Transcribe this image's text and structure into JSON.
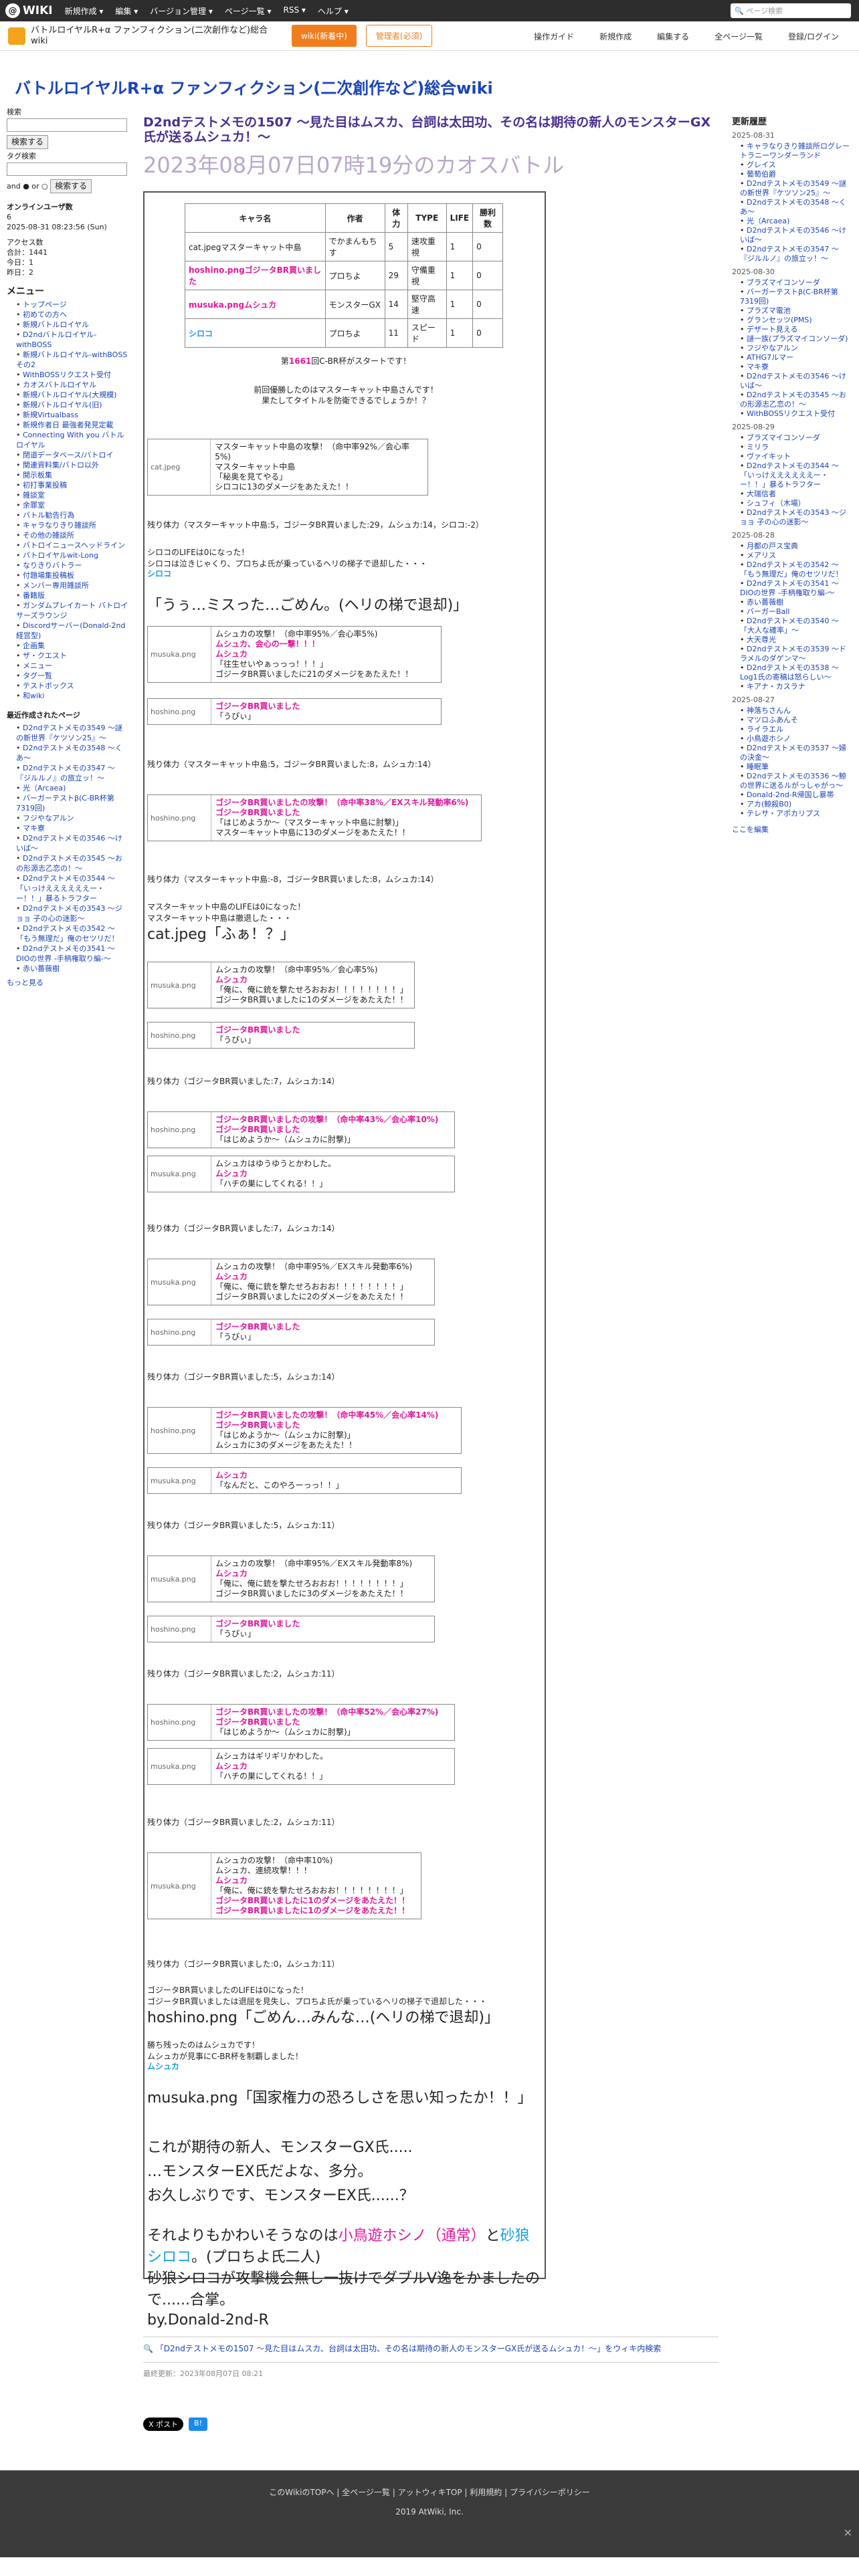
{
  "topbar": {
    "logo": "WIKI",
    "menu": [
      "新規作成 ▾",
      "編集 ▾",
      "バージョン管理 ▾",
      "ページ一覧 ▾",
      "RSS ▾",
      "ヘルプ ▾"
    ],
    "search_placeholder": "ページ検索"
  },
  "subbar": {
    "site": "バトルロイヤルR+α ファンフィクション(二次創作など)総合wiki",
    "btn1": "wiki(新着中)",
    "btn2": "管理者(必須)",
    "tools": [
      "操作ガイド",
      "新規作成",
      "編集する",
      "全ページ一覧",
      "登録/ログイン"
    ]
  },
  "site_title": "バトルロイヤルR+α ファンフィクション(二次創作など)総合wiki",
  "left": {
    "label_search": "検索",
    "btn_search": "検索する",
    "label_tag": "タグ検索",
    "and_or": "and ● or ○",
    "btn_search2": "検索する",
    "online_title": "オンラインユーザ数",
    "online_val": "6",
    "time": "2025-08-31 08:23:56 (Sun)",
    "access": "アクセス数",
    "total": "合計：1441",
    "today": "今日：1",
    "yesterday": "昨日：2",
    "menu_title": "メニュー",
    "menu": [
      "トップページ",
      "初めての方へ",
      "新規バトルロイヤル",
      "D2ndバトルロイヤル-withBOSS",
      "新規バトルロイヤル-withBOSSその2",
      "WithBOSSリクエスト受付",
      "カオスバトルロイヤル",
      "新規バトルロイヤル(大規模)",
      "新規バトルロイヤル(旧)",
      "新規Virtualbass",
      "新規作者日 最強者発見定載",
      "Connecting With you バトルロイヤル",
      "閉道データベース/バトロイ",
      "関連資料集/バトロ以外",
      "開示板集",
      "初打事業投稿",
      "雑談室",
      "余罪室",
      "バトル勧告行為",
      "キャラなりきり雑談所",
      "その他の雑談所",
      "バトロイニュースヘッドライン",
      "バトロイヤルwit-Long",
      "なりきりバトラー",
      "付題場集投稿板",
      "メンバー専用雑談所",
      "番籍版",
      "ガンダムプレイカート バトロイサーズラウンジ",
      "Discordサーバー(Donald-2nd経営型)",
      "企画集",
      "ザ・クエスト",
      "メニュー",
      "タグ一覧",
      "テストボックス",
      "和wiki"
    ],
    "recent_title": "最近作成されたページ",
    "recent": [
      "D2ndテストメモの3549 ～謎の新世界『ケツソン25』～",
      "D2ndテストメモの3548 ～くあ～",
      "D2ndテストメモの3547 ～『ジルルノ』の旅立ッ！～",
      "光（Arcaea)",
      "バーガーテストβ(C-BR杯第7319回)",
      "フジやなアルン",
      "マキ寮",
      "D2ndテストメモの3546 ～けいば～",
      "D2ndテストメモの3545 ～おの形源志乙恋の！～",
      "D2ndテストメモの3544 ～「いっけええええええー・ー！！」暴るトラフター",
      "D2ndテストメモの3543 ～ジョョ 子の心の迷影～",
      "D2ndテストメモの3542 ～「もう無理だ」俺のセツリだ！",
      "D2ndテストメモの3541 ～DIOの世界 -手柄権取り編-～",
      "赤い薔薇樹"
    ],
    "more": "もっと見る"
  },
  "main": {
    "heading": "D2ndテストメモの1507 ～見た目はムスカ、台詞は太田功、その名は期待の新人のモンスターGX氏が送るムシュカ！～",
    "date": "2023年08月07日07時19分のカオスバトル",
    "roster_head": [
      "キャラ名",
      "作者",
      "体力",
      "TYPE",
      "LIFE",
      "勝利数"
    ],
    "roster": [
      [
        "cat.jpegマスターキャット中島",
        "でかまんもちす",
        "5",
        "速攻重視",
        "1",
        "0"
      ],
      [
        "hoshino.pngゴジータBR買いました",
        "プロちよ",
        "29",
        "守備重視",
        "1",
        "0"
      ],
      [
        "musuka.pngムシュカ",
        "モンスターGX",
        "14",
        "堅守高速",
        "1",
        "0"
      ],
      [
        "シロコ",
        "プロちよ",
        "11",
        "スピード",
        "1",
        "0"
      ]
    ],
    "intro1_pre": "第",
    "intro1_num": "1661",
    "intro1_post": "回C-BR杯がスタートです！",
    "intro2": "前回優勝したのはマスターキャット中島さんです！",
    "intro3": "果たしてタイトルを防衛できるでしょうか！？",
    "b1": [
      "マスターキャット中島の攻撃！（命中率92%／会心率5%)",
      "マスターキャット中島",
      "「秘奥を見てやる」",
      "シロコに13のダメージをあたえた！！"
    ],
    "r1": "残り体力（マスターキャット中島:5，ゴジータBR買いました:29，ムシュカ:14，シロコ:-2）",
    "n1": "シロコのLIFEは0になった！",
    "n2": "シロコは泣きじゃくり、プロちよ氏が乗っているヘリの梯子で退却した・・・",
    "n3": "シロコ",
    "n4": "「うぅ…ミスった…ごめん。(ヘリの梯で退却)」",
    "b2": [
      "ムシュカの攻撃！（命中率95%／会心率5%)",
      "ムシュカ、会心の一撃！！！",
      "ムシュカ",
      "「往生せいやぁっっっ！！！」",
      "ゴジータBR買いましたに21のダメージをあたえた！！"
    ],
    "b3": [
      "ゴジータBR買いました",
      "「うぴぃ」"
    ],
    "r2": "残り体力（マスターキャット中島:5，ゴジータBR買いました:8，ムシュカ:14）",
    "b4": [
      "ゴジータBR買いましたの攻撃！（命中率38%／EXスキル発動率6%)",
      "ゴジータBR買いました",
      "「はじめようか～（マスターキャット中島に肘撃)」",
      "マスターキャット中島に13のダメージをあたえた！！"
    ],
    "r3": "残り体力（マスターキャット中島:-8，ゴジータBR買いました:8，ムシュカ:14）",
    "n5": "マスターキャット中島のLIFEは0になった！",
    "n6": "マスターキャット中島は撤退した・・・",
    "n7": "cat.jpeg「ふぁ！？」",
    "b5": [
      "ムシュカの攻撃！（命中率95%／会心率5%)",
      "ムシュカ",
      "「俺に、俺に銃を撃たせろおおお！！！！！！！！」",
      "ゴジータBR買いましたに1のダメージをあたえた！！"
    ],
    "b6": [
      "ゴジータBR買いました",
      "「うぴぃ」"
    ],
    "r4": "残り体力（ゴジータBR買いました:7，ムシュカ:14）",
    "b7": [
      "ゴジータBR買いましたの攻撃！（命中率43%／会心率10%)",
      "ゴジータBR買いました",
      "「はじめようか～（ムシュカに肘撃)」"
    ],
    "b8": [
      "ムシュカはゆうゆうとかわした。",
      "ムシュカ",
      "「ハチの巣にしてくれる！！」"
    ],
    "r5": "残り体力（ゴジータBR買いました:7，ムシュカ:14）",
    "b9": [
      "ムシュカの攻撃！（命中率95%／EXスキル発動率6%)",
      "ムシュカ",
      "「俺に、俺に銃を撃たせろおおお！！！！！！！！」",
      "ゴジータBR買いましたに2のダメージをあたえた！！"
    ],
    "b10": [
      "ゴジータBR買いました",
      "「うぴぃ」"
    ],
    "r6": "残り体力（ゴジータBR買いました:5，ムシュカ:14）",
    "b11": [
      "ゴジータBR買いましたの攻撃！（命中率45%／会心率14%)",
      "ゴジータBR買いました",
      "「はじめようか～（ムシュカに肘撃)」",
      "ムシュカに3のダメージをあたえた！！"
    ],
    "b12": [
      "ムシュカ",
      "「なんだと、このやろーっっ！！」"
    ],
    "r7": "残り体力（ゴジータBR買いました:5，ムシュカ:11）",
    "b13": [
      "ムシュカの攻撃！（命中率95%／EXスキル発動率8%)",
      "ムシュカ",
      "「俺に、俺に銃を撃たせろおおお！！！！！！！！」",
      "ゴジータBR買いましたに3のダメージをあたえた！！"
    ],
    "b14": [
      "ゴジータBR買いました",
      "「うぴぃ」"
    ],
    "r8": "残り体力（ゴジータBR買いました:2，ムシュカ:11）",
    "b15": [
      "ゴジータBR買いましたの攻撃！（命中率52%／会心率27%)",
      "ゴジータBR買いました",
      "「はじめようか～（ムシュカに肘撃)」"
    ],
    "b16": [
      "ムシュカはギリギリかわした。",
      "ムシュカ",
      "「ハチの巣にしてくれる！！」"
    ],
    "r9": "残り体力（ゴジータBR買いました:2，ムシュカ:11）",
    "b17": [
      "ムシュカの攻撃！（命中率10%)",
      "ムシュカ、連続攻撃！！！",
      "ムシュカ",
      "「俺に、俺に銃を撃たせろおおお！！！！！！！！」",
      "ゴジータBR買いましたに1のダメージをあたえた！！",
      "ゴジータBR買いましたに1のダメージをあたえた！！"
    ],
    "r10": "残り体力（ゴジータBR買いました:0，ムシュカ:11）",
    "n8": "ゴジータBR買いましたのLIFEは0になった！",
    "n9": "ゴジータBR買いましたは退屈を見失し、プロちよ氏が乗っているヘリの梯子で退却した・・・",
    "n10": "hoshino.png「ごめん…みんな…(ヘリの梯で退却)」",
    "n11": "勝ち残ったのはムシュカです！",
    "n12": "ムシュカが見事にC-BR杯を制覇しました！",
    "n13": "ムシュカ",
    "n14": "musuka.png「国家権力の恐ろしさを思い知ったか！！」",
    "n15": "これが期待の新人、モンスターGX氏.....",
    "n16": "…モンスターEX氏だよな、多分。",
    "n17": "お久しぶりです、モンスターEX氏......？",
    "n18a": "それよりもかわいそうなのは",
    "n18b": "小鳥遊ホシノ（通常）",
    "n18c": "と",
    "n18d": "砂狼シロコ",
    "n18e": "。(プロちよ氏二人)",
    "n19": "砂狼シロコが攻撃機会無し一抜けでダブルV逸をかましたので......合掌。",
    "n20": "by.Donald-2nd-R"
  },
  "bottom": {
    "link": "「D2ndテストメモの1507 ～見た目はムスカ、台詞は太田功、その名は期待の新人のモンスターGX氏が送るムシュカ！～」をウィキ内検索",
    "updated": "最終更新：2023年08月07日 08:21",
    "tweet": "X ポスト",
    "share": "B!"
  },
  "right": {
    "title": "更新履歴",
    "groups": [
      {
        "date": "2025-08-31",
        "items": [
          "キャラなりきり雑談所ログレートラニーワンダーランド",
          "グレイス",
          "葡萄伯爵",
          "D2ndテストメモの3549 ～謎の新世界『ケツソン25』～",
          "D2ndテストメモの3548 ～くあ～",
          "光（Arcaea)",
          "D2ndテストメモの3546 ～けいば～",
          "D2ndテストメモの3547 ～『ジルルノ』の旅立ッ！～"
        ]
      },
      {
        "date": "2025-08-30",
        "items": [
          "ブラズマイコンソーダ",
          "バーガーテストβ(C-BR杯第7319回)",
          "プラズマ電池",
          "グランセッツ(PMS)",
          "デザート見える",
          "謎一族(プラズマイコンソーダ)",
          "フジやなアルン",
          "ATHG7ルマー",
          "マキ寮",
          "D2ndテストメモの3546 ～けいば～",
          "D2ndテストメモの3545 ～おの形源志乙恋の！～",
          "WithBOSSリクエスト受付"
        ]
      },
      {
        "date": "2025-08-29",
        "items": [
          "ブラズマイコンソーダ",
          "ミリラ",
          "ヴァイキット",
          "D2ndテストメモの3544 ～「いっけええええええー・ー！！」暴るトラフター",
          "大瑞信者",
          "シュフィ（木場）",
          "D2ndテストメモの3543 ～ジョョ 子の心の迷影～"
        ]
      },
      {
        "date": "2025-08-28",
        "items": [
          "月都の戸ス宝典",
          "メアリス",
          "D2ndテストメモの3542 ～「もう無理だ」俺のセツリだ！",
          "D2ndテストメモの3541 ～DIOの世界 -手柄権取り編-～",
          "赤い薔薇樹",
          "バーガーBall",
          "D2ndテストメモの3540 ～「大人な確率」～",
          "大天尊光",
          "D2ndテストメモの3539 ～ドラメルのダゲンマ～",
          "D2ndテストメモの3538 ～Log1氏の寄稿は怒らしい～",
          "キアナ・カスラナ"
        ]
      },
      {
        "date": "2025-08-27",
        "items": [
          "神落ちさんん",
          "マツロふあんそ",
          "ライラエル",
          "小鳥遊ホシノ",
          "D2ndテストメモの3537 ～婦の決金～",
          "睡眠筆",
          "D2ndテストメモの3536 ～鯨の世界に送るルがっしゃがっ～",
          "Donald-2nd-R帰国し暴帯",
          "アカ(鯨殺B0)",
          "テレサ・アポカリプス"
        ]
      }
    ],
    "edit": "ここを編集"
  },
  "footer": {
    "links": [
      "このWikiのTOPへ",
      "全ページ一覧",
      "アットウィキTOP",
      "利用規約",
      "プライバシーポリシー"
    ],
    "copy": "2019 AtWiki, Inc."
  }
}
